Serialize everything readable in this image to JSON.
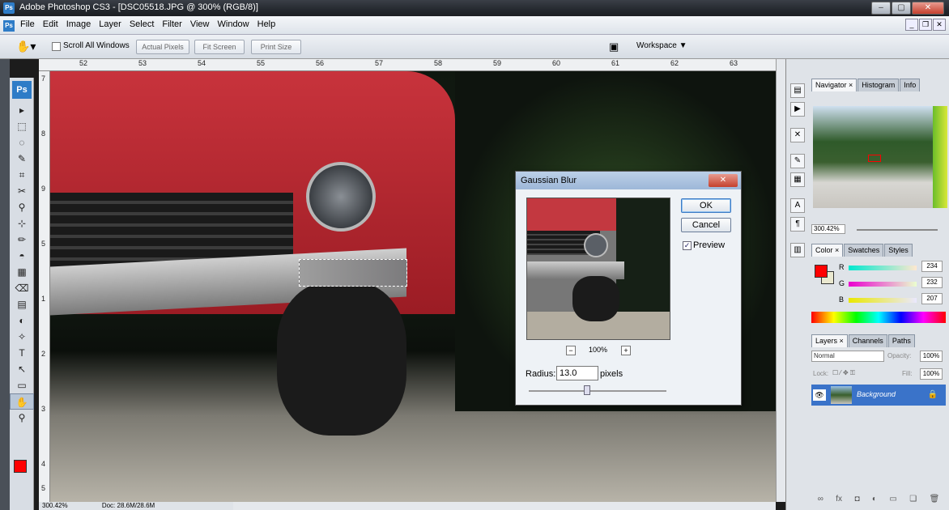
{
  "window": {
    "title": "Adobe Photoshop CS3 - [DSC05518.JPG @ 300% (RGB/8)]",
    "app_badge": "Ps"
  },
  "menu": [
    "File",
    "Edit",
    "Image",
    "Layer",
    "Select",
    "Filter",
    "View",
    "Window",
    "Help"
  ],
  "options_bar": {
    "scroll_all_windows": "Scroll All Windows",
    "actual_pixels": "Actual Pixels",
    "fit_screen": "Fit Screen",
    "print_size": "Print Size",
    "workspace": "Workspace ▼"
  },
  "rulers": {
    "top": [
      "52",
      "53",
      "54",
      "55",
      "56",
      "57",
      "58",
      "59",
      "60",
      "61",
      "62",
      "63"
    ],
    "left": [
      "7",
      "8",
      "9",
      "5",
      "1",
      "2",
      "3",
      "4",
      "5"
    ]
  },
  "status": {
    "zoom": "300.42%",
    "doc": "Doc: 28.6M/28.6M"
  },
  "dialog": {
    "title": "Gaussian Blur",
    "ok": "OK",
    "cancel": "Cancel",
    "preview_label": "Preview",
    "zoom": "100%",
    "radius_label": "Radius:",
    "radius_value": "13.0",
    "radius_unit": "pixels"
  },
  "navigator": {
    "tabs": [
      "Navigator ×",
      "Histogram",
      "Info"
    ],
    "zoom": "300.42%"
  },
  "color": {
    "tabs": [
      "Color ×",
      "Swatches",
      "Styles"
    ],
    "channels": [
      {
        "label": "R",
        "value": "234",
        "gradient": "linear-gradient(90deg,#00e8cf,#ffe8cf)"
      },
      {
        "label": "G",
        "value": "232",
        "gradient": "linear-gradient(90deg,#ea00cf,#eaffcf)"
      },
      {
        "label": "B",
        "value": "207",
        "gradient": "linear-gradient(90deg,#eae800,#eae8ff)"
      }
    ]
  },
  "layers": {
    "tabs": [
      "Layers ×",
      "Channels",
      "Paths"
    ],
    "mode": "Normal",
    "opacity_label": "Opacity:",
    "opacity": "100%",
    "lock_label": "Lock:",
    "fill_label": "Fill:",
    "fill": "100%",
    "items": [
      {
        "name": "Background"
      }
    ]
  },
  "tools": [
    "▸",
    "⬚",
    "◌",
    "✎",
    "⌗",
    "✂",
    "⚲",
    "⊹",
    "✏",
    "◓",
    "▦",
    "⌫",
    "▤",
    "◐",
    "✧",
    "T",
    "↖",
    "▭",
    "✋",
    "⚲"
  ]
}
